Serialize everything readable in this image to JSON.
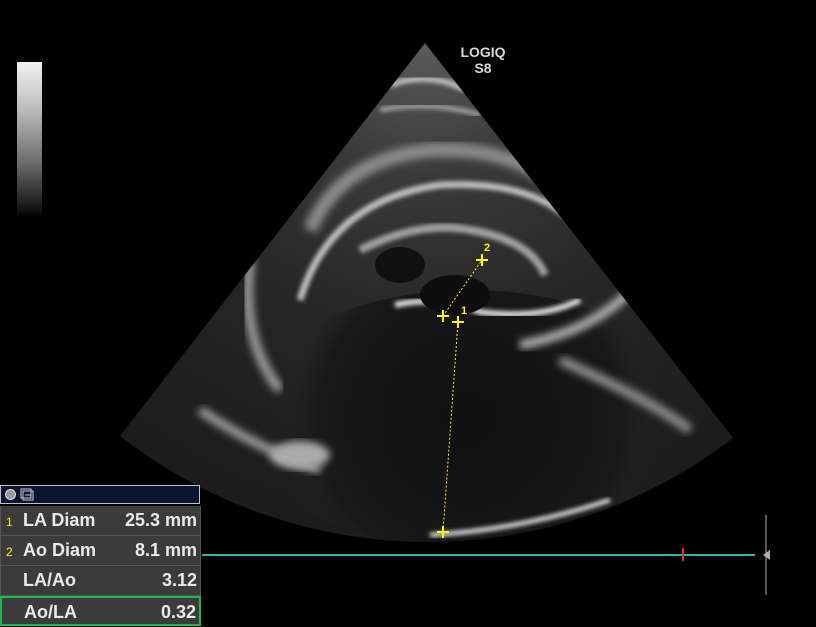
{
  "device": {
    "model_line1": "LOGIQ",
    "model_line2": "S8"
  },
  "calipers": {
    "marker_1": "1",
    "marker_2": "2"
  },
  "measurements": [
    {
      "index": "1",
      "label": "LA Diam",
      "value": "25.3 mm"
    },
    {
      "index": "2",
      "label": "Ao Diam",
      "value": "8.1 mm"
    },
    {
      "index": "",
      "label": "LA/Ao",
      "value": "3.12"
    },
    {
      "index": "",
      "label": "Ao/LA",
      "value": "0.32"
    }
  ],
  "colors": {
    "caliper": "#fff600",
    "timeline": "#2fb6a8",
    "active_row": "#1fb84a",
    "header": "#0b1433"
  },
  "icons": {
    "header_left": "circle-icon",
    "header_right": "image-clip-icon"
  }
}
